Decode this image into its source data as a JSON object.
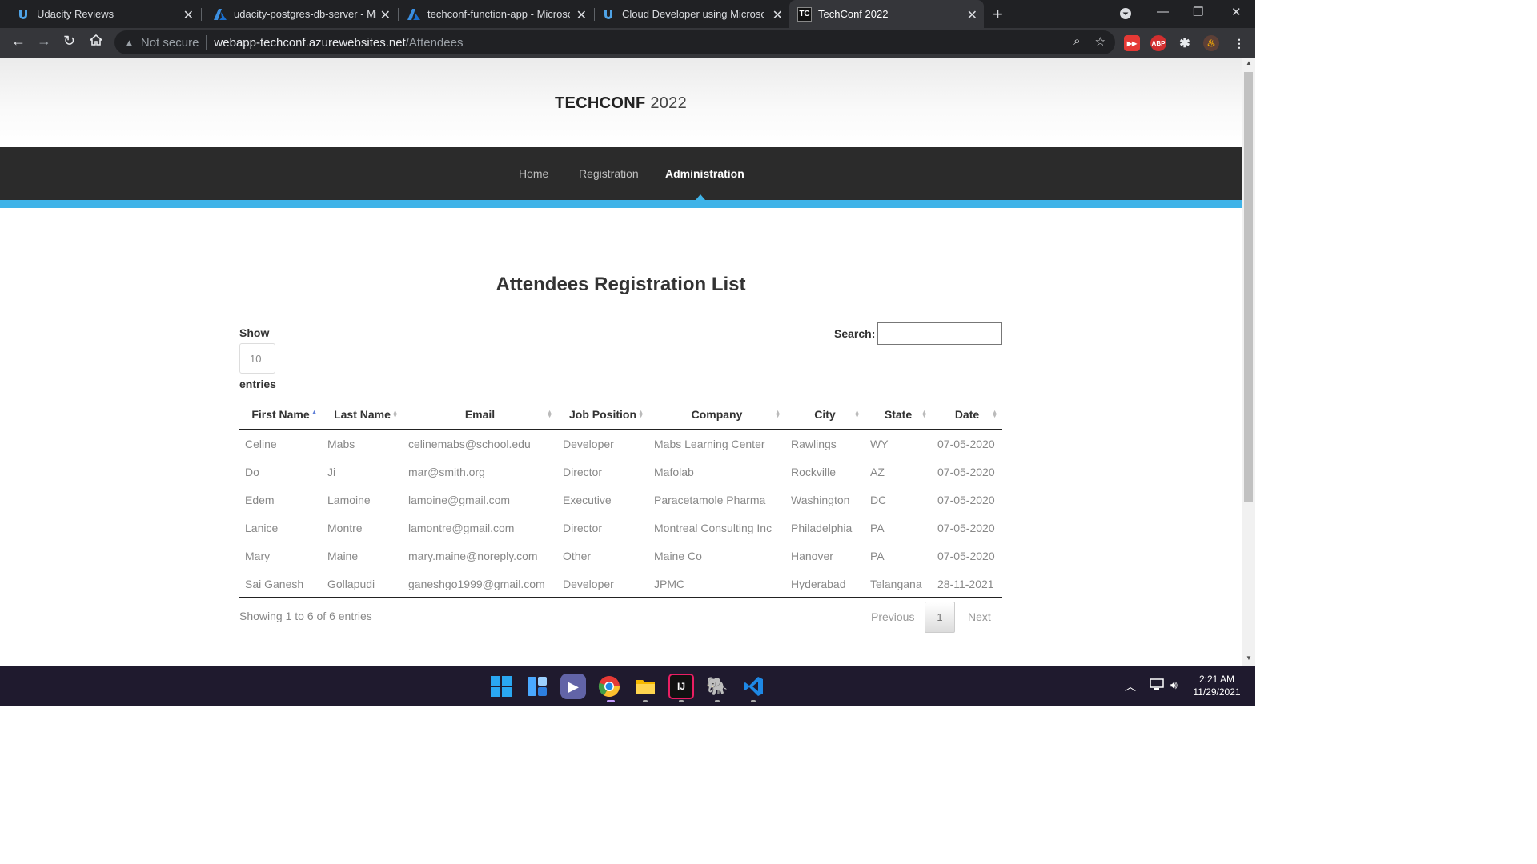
{
  "browser": {
    "tabs": [
      {
        "title": "Udacity Reviews",
        "favicon": "udacity-icon"
      },
      {
        "title": "udacity-postgres-db-server - Mic",
        "favicon": "azure-icon"
      },
      {
        "title": "techconf-function-app - Microso",
        "favicon": "azure-icon"
      },
      {
        "title": "Cloud Developer using Microsoft",
        "favicon": "udacity-icon"
      },
      {
        "title": "TechConf 2022",
        "favicon": "TC"
      }
    ],
    "security_label": "Not secure",
    "url_host": "webapp-techconf.azurewebsites.net",
    "url_path": "/Attendees",
    "extensions": [
      "ABP"
    ]
  },
  "site": {
    "brand_bold": "TECHCONF",
    "brand_year": "2022",
    "nav": [
      {
        "label": "Home"
      },
      {
        "label": "Registration"
      },
      {
        "label": "Administration"
      }
    ]
  },
  "main": {
    "heading": "Attendees Registration List",
    "show_label": "Show",
    "page_length": "10",
    "entries_label": "entries",
    "search_label": "Search:",
    "search_value": "",
    "columns": [
      "First Name",
      "Last Name",
      "Email",
      "Job Position",
      "Company",
      "City",
      "State",
      "Date"
    ],
    "rows": [
      [
        "Celine",
        "Mabs",
        "celinemabs@school.edu",
        "Developer",
        "Mabs Learning Center",
        "Rawlings",
        "WY",
        "07-05-2020"
      ],
      [
        "Do",
        "Ji",
        "mar@smith.org",
        "Director",
        "Mafolab",
        "Rockville",
        "AZ",
        "07-05-2020"
      ],
      [
        "Edem",
        "Lamoine",
        "lamoine@gmail.com",
        "Executive",
        "Paracetamole Pharma",
        "Washington",
        "DC",
        "07-05-2020"
      ],
      [
        "Lanice",
        "Montre",
        "lamontre@gmail.com",
        "Director",
        "Montreal Consulting Inc",
        "Philadelphia",
        "PA",
        "07-05-2020"
      ],
      [
        "Mary",
        "Maine",
        "mary.maine@noreply.com",
        "Other",
        "Maine Co",
        "Hanover",
        "PA",
        "07-05-2020"
      ],
      [
        "Sai Ganesh",
        "Gollapudi",
        "ganeshgo1999@gmail.com",
        "Developer",
        "JPMC",
        "Hyderabad",
        "Telangana",
        "28-11-2021"
      ]
    ],
    "info": "Showing 1 to 6 of 6 entries",
    "pagination": {
      "previous": "Previous",
      "current": "1",
      "next": "Next"
    }
  },
  "taskbar": {
    "time": "2:21 AM",
    "date": "11/29/2021"
  },
  "colors": {
    "accent": "#3fb3e8",
    "nav_bg": "#2b2b2b",
    "chrome_bg": "#202124"
  }
}
